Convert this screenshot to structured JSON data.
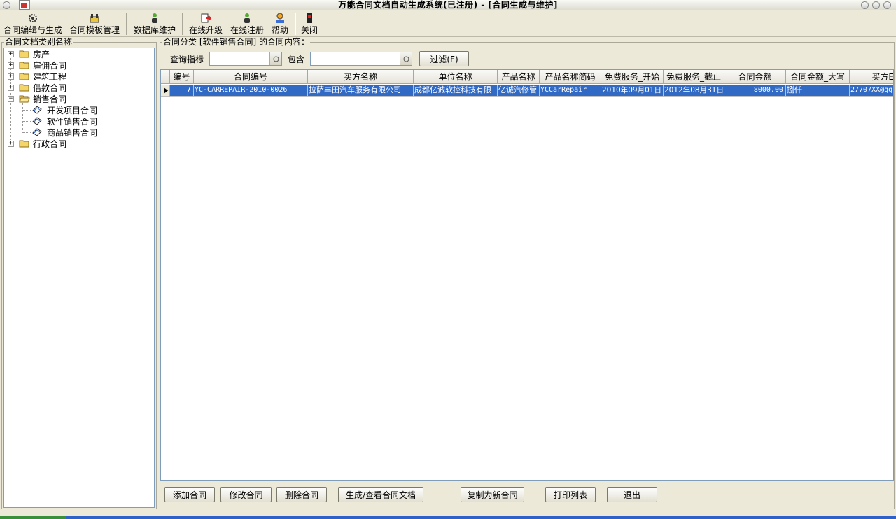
{
  "window": {
    "title": "万能合同文档自动生成系统(已注册) - [合同生成与维护]"
  },
  "toolbar": {
    "items": [
      {
        "label": "合同编辑与生成",
        "icon": "gear-icon"
      },
      {
        "label": "合同模板管理",
        "icon": "template-icon"
      },
      {
        "label": "数据库维护",
        "icon": "user-db-icon"
      },
      {
        "label": "在线升级",
        "icon": "upgrade-icon"
      },
      {
        "label": "在线注册",
        "icon": "register-icon"
      },
      {
        "label": "帮助",
        "icon": "help-icon"
      },
      {
        "label": "关闭",
        "icon": "close-door-icon"
      }
    ]
  },
  "tree": {
    "legend": "合同文档类别名称",
    "nodes": [
      {
        "label": "房产",
        "expander": "+"
      },
      {
        "label": "雇佣合同",
        "expander": "+"
      },
      {
        "label": "建筑工程",
        "expander": "+"
      },
      {
        "label": "借款合同",
        "expander": "+"
      },
      {
        "label": "销售合同",
        "expander": "−"
      },
      {
        "label": "开发项目合同"
      },
      {
        "label": "软件销售合同"
      },
      {
        "label": "商品销售合同"
      },
      {
        "label": "行政合同",
        "expander": "+"
      }
    ]
  },
  "main": {
    "legend": "合同分类 [软件销售合同] 的合同内容：",
    "filter": {
      "query_label": "查询指标",
      "contains_label": "包含",
      "query_value": "",
      "contains_value": "",
      "filter_button": "过滤(F)"
    },
    "columns": [
      "编号",
      "合同编号",
      "买方名称",
      "单位名称",
      "产品名称",
      "产品名称简码",
      "免费服务_开始",
      "免费服务_截止",
      "合同金额",
      "合同金额_大写",
      "买方E"
    ],
    "rows": [
      [
        "7",
        "YC-CARREPAIR-2010-0026",
        "拉萨丰田汽车服务有限公司",
        "成都亿诚软控科技有限",
        "亿诚汽修管",
        "YCCarRepair",
        "2010年09月01日",
        "2012年08月31日",
        "8000.00",
        "捌仟",
        "27707XX@qq"
      ]
    ],
    "buttons": {
      "add": "添加合同",
      "edit": "修改合同",
      "delete": "删除合同",
      "generate": "生成/查看合同文档",
      "copy": "复制为新合同",
      "print": "打印列表",
      "exit": "退出"
    }
  },
  "colors": {
    "selection": "#316ac5",
    "face": "#ece9d8",
    "taskbar": "#2f62c9"
  }
}
